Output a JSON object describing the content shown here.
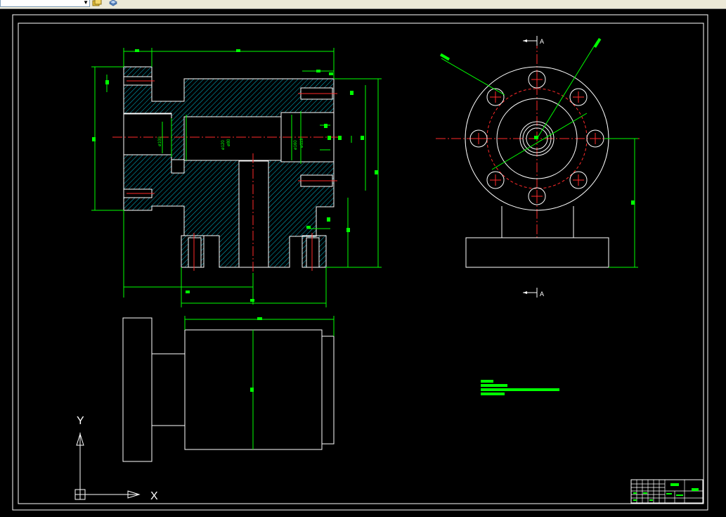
{
  "toolbar": {
    "layer_combo_value": "",
    "combo_arrow_icon": "chevron-down-icon",
    "buttons": [
      "layer-state-icon",
      "layer-properties-icon"
    ]
  },
  "drawing": {
    "section_label_top": "A",
    "section_label_bottom": "A",
    "dim_labels": [
      "ø100",
      "ø120",
      "ø80",
      "ø160",
      "ø113"
    ],
    "ucs_y": "Y",
    "ucs_x": "X"
  },
  "colors": {
    "background": "#000000",
    "geometry": "#ffffff",
    "dimension": "#00ff00",
    "hatch": "#00bcd4",
    "centerline": "#ff2a2a"
  }
}
